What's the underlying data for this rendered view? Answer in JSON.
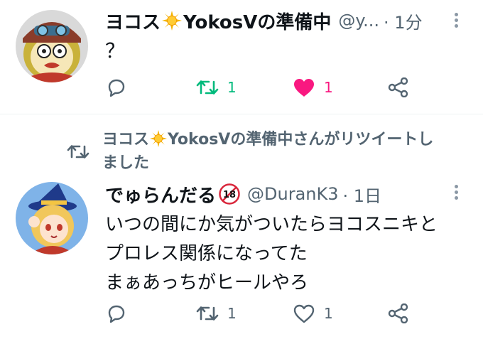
{
  "tweet1": {
    "display_name_part1": "ヨコス",
    "display_name_part2": "YokosⅤの準備中",
    "handle": "@y...",
    "time": "· 1分",
    "text": "？",
    "actions": {
      "reply_icon": "reply-icon",
      "retweet_icon": "retweet-icon",
      "retweet_count": "1",
      "like_icon": "heart-filled-icon",
      "like_count": "1",
      "share_icon": "share-icon"
    },
    "colors": {
      "retweet": "#00ba7c",
      "like": "#f91880"
    }
  },
  "retweet_banner": {
    "name_part1": "ヨコス",
    "name_part2": "YokosⅤの準備中さんがリツイートし",
    "line2": "ました"
  },
  "tweet2": {
    "display_name": "でゅらんだる",
    "badge": "18",
    "handle": "@DuranK3",
    "time": "· 1日",
    "text_lines": [
      "いつの間にか気がついたらヨコスニキと",
      "プロレス関係になってた",
      "まぁあっちがヒールやろ"
    ],
    "actions": {
      "reply_icon": "reply-icon",
      "retweet_icon": "retweet-icon",
      "retweet_count": "1",
      "like_icon": "heart-outline-icon",
      "like_count": "1",
      "share_icon": "share-icon"
    }
  }
}
